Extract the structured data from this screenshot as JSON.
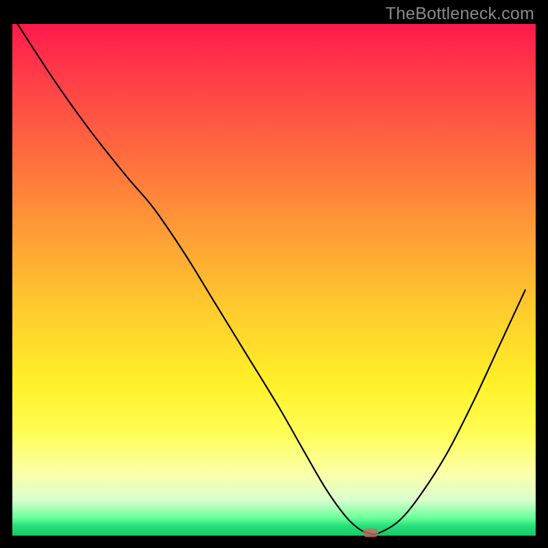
{
  "watermark": "TheBottleneck.com",
  "colors": {
    "curve": "#000000",
    "marker": "#c46b66"
  },
  "chart_data": {
    "type": "line",
    "title": "",
    "xlabel": "",
    "ylabel": "",
    "xlim": [
      0,
      100
    ],
    "ylim": [
      0,
      100
    ],
    "grid": false,
    "series": [
      {
        "name": "bottleneck-curve",
        "x": [
          1,
          8,
          15,
          22,
          27,
          33,
          39,
          45,
          51,
          56,
          60,
          63.5,
          66,
          68,
          70,
          74,
          78,
          83,
          88,
          93,
          98
        ],
        "y": [
          100,
          89,
          79,
          70,
          64,
          55,
          45,
          35,
          25,
          16,
          9,
          4,
          1.5,
          0.5,
          0.5,
          3,
          8,
          16,
          26,
          37,
          48
        ]
      }
    ],
    "marker": {
      "x": 68.5,
      "y": 0.6,
      "width_pct": 3.0,
      "height_pct": 1.8,
      "color": "#c46b66"
    }
  }
}
